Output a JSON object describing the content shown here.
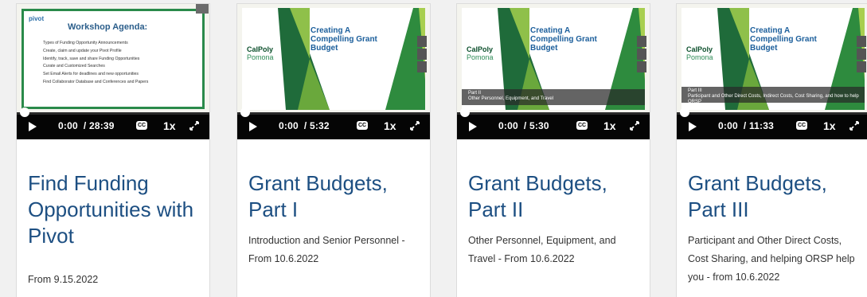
{
  "cards": [
    {
      "title": "Find Funding Opportunities with Pivot",
      "description": "From 9.15.2022",
      "time": "0:00",
      "duration": "/ 28:39",
      "speed": "1x",
      "cc": "CC",
      "slide": {
        "logo": "pivot",
        "heading": "Workshop Agenda:",
        "items": [
          "Types of Funding Opportunity Announcements",
          "Create, claim and update your Pivot Profile",
          "Identify, track, save and share Funding Opportunities",
          "Curate and Customized Searches",
          "Set Email Alerts for deadlines and new opportunities",
          "Find Collaborator Database and Conferences and Papers"
        ]
      }
    },
    {
      "title": "Grant Budgets, Part I",
      "description": "Introduction and Senior Personnel - From 10.6.2022",
      "time": "0:00",
      "duration": "/ 5:32",
      "speed": "1x",
      "cc": "CC",
      "slide": {
        "logo_top": "CalPoly",
        "logo_bottom": "Pomona",
        "heading": "Creating A Compelling Grant Budget",
        "part_label": "",
        "part_sub": ""
      }
    },
    {
      "title": "Grant Budgets, Part II",
      "description": "Other Personnel, Equipment, and Travel - From 10.6.2022",
      "time": "0:00",
      "duration": "/ 5:30",
      "speed": "1x",
      "cc": "CC",
      "slide": {
        "logo_top": "CalPoly",
        "logo_bottom": "Pomona",
        "heading": "Creating A Compelling Grant Budget",
        "part_label": "Part II",
        "part_sub": "Other Personnel, Equipment, and Travel"
      }
    },
    {
      "title": "Grant Budgets, Part III",
      "description": "Participant and Other Direct Costs, Cost Sharing, and helping ORSP help you - from 10.6.2022",
      "time": "0:00",
      "duration": "/ 11:33",
      "speed": "1x",
      "cc": "CC",
      "slide": {
        "logo_top": "CalPoly",
        "logo_bottom": "Pomona",
        "heading": "Creating A Compelling Grant Budget",
        "part_label": "Part III",
        "part_sub": "Participant and Other Direct Costs, Indirect Costs, Cost Sharing, and how to help ORSP"
      }
    }
  ],
  "colors": {
    "title": "#1d4f82",
    "controls_bg": "#050505",
    "slide_green": "#2a8a4a"
  }
}
